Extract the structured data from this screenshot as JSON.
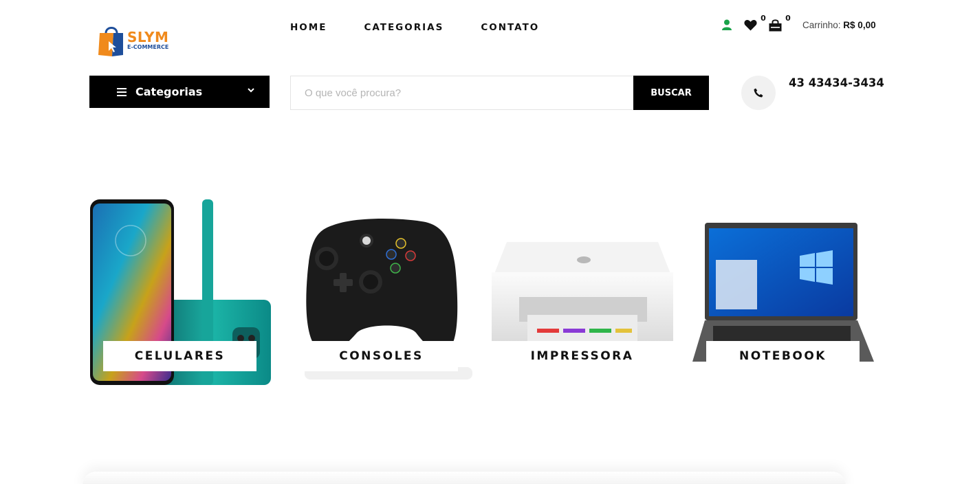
{
  "brand": {
    "name": "SLYM",
    "tagline": "E-COMMERCE",
    "primary_color": "#f08a1c",
    "secondary_color": "#1e4e9a"
  },
  "nav": {
    "items": [
      {
        "label": "HOME"
      },
      {
        "label": "CATEGORIAS"
      },
      {
        "label": "CONTATO"
      }
    ]
  },
  "header": {
    "user_icon": "user-icon",
    "user_icon_color": "#1aa34a",
    "wishlist": {
      "icon": "heart-icon",
      "count": "0"
    },
    "cart": {
      "icon": "shopping-bag-icon",
      "count": "0",
      "label": "Carrinho:",
      "total": "R$ 0,00"
    }
  },
  "search": {
    "categories_label": "Categorias",
    "placeholder": "O que você procura?",
    "value": "",
    "button_label": "BUSCAR"
  },
  "contact": {
    "icon": "phone-icon",
    "phone": "43 43434-3434"
  },
  "categories": [
    {
      "label": "CELULARES",
      "image": "smartphone"
    },
    {
      "label": "CONSOLES",
      "image": "game-controller"
    },
    {
      "label": "IMPRESSORA",
      "image": "printer"
    },
    {
      "label": "NOTEBOOK",
      "image": "laptop"
    }
  ]
}
